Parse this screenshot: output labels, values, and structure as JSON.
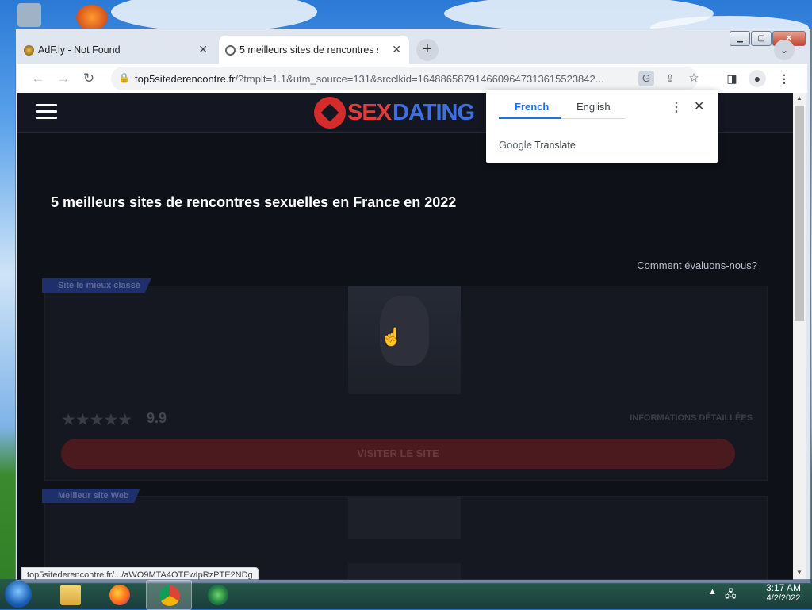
{
  "browser": {
    "tabs": [
      {
        "title": "AdF.ly - Not Found",
        "active": false
      },
      {
        "title": "5 meilleurs sites de rencontres se",
        "active": true
      }
    ],
    "url_host": "top5sitederencontre.fr",
    "url_rest": "/?tmplt=1.1&utm_source=131&srcclkid=1648865879146609647313615523842...",
    "status_url": "top5sitederencontre.fr/.../aWO9MTA4OTEwIpRzPTE2NDg"
  },
  "translate_popup": {
    "lang_from": "French",
    "lang_to": "English",
    "brand": "Google",
    "brand_suffix": "Translate"
  },
  "site": {
    "logo_sex": "SEX",
    "logo_dating": "DATING",
    "title": "5 meilleurs sites de rencontres sexuelles en France en 2022",
    "how_link": "Comment évaluons-nous?",
    "cards": [
      {
        "badge": "Site le mieux classé",
        "stars": "★★★★★",
        "score": "9.9",
        "details": "INFORMATIONS DÉTAILLÉES",
        "cta": "VISITER LE SITE"
      },
      {
        "badge": "Meilleur site Web"
      }
    ]
  },
  "taskbar": {
    "time": "3:17 AM",
    "date": "4/2/2022"
  },
  "colors": {
    "accent_blue": "#1a73e8",
    "page_bg": "#0f1119",
    "logo_red": "#e23b3b",
    "logo_blue": "#3b6fe2"
  }
}
